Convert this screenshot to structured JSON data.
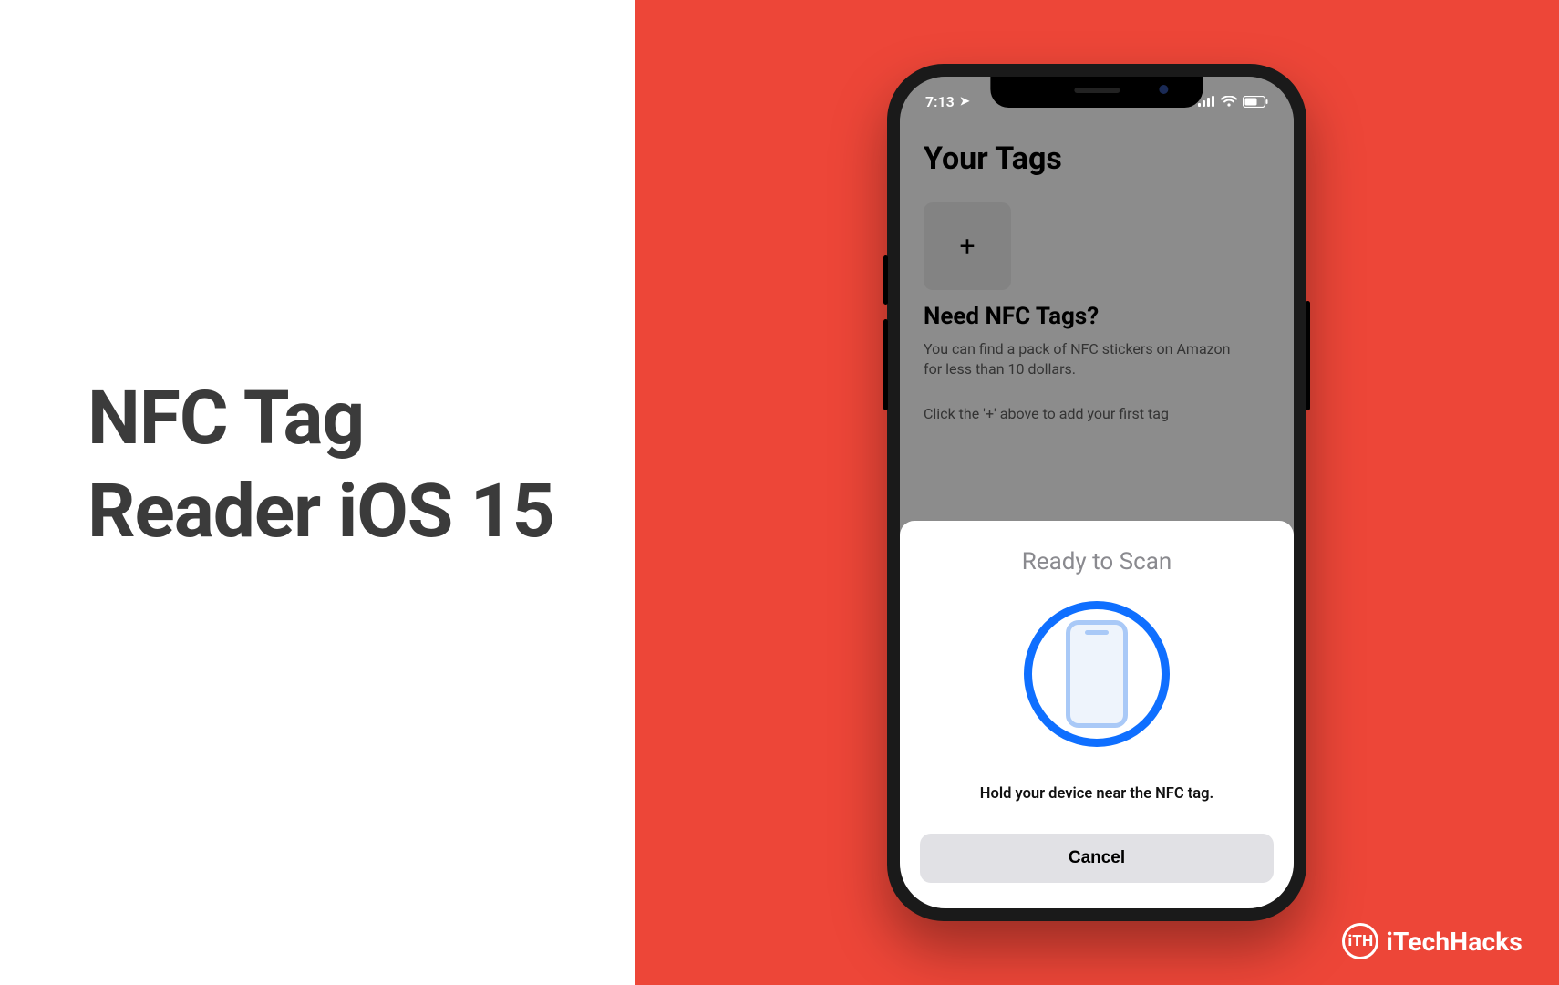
{
  "left": {
    "title_line1": "NFC Tag",
    "title_line2_a": "Reader ",
    "title_line2_b": "iOS 15"
  },
  "phone": {
    "status": {
      "time": "7:13",
      "location_glyph": "➤"
    },
    "app": {
      "title": "Your Tags",
      "add_glyph": "+",
      "need_title": "Need NFC Tags?",
      "need_body": "You can find a pack of NFC stickers on Amazon for less than 10 dollars.",
      "hint": "Click the '+' above to add your first tag"
    },
    "sheet": {
      "title": "Ready to Scan",
      "message": "Hold your device near the NFC tag.",
      "cancel": "Cancel"
    }
  },
  "watermark": {
    "badge": "iTH",
    "text": "iTechHacks"
  },
  "colors": {
    "accent_red": "#ed4638",
    "scan_blue": "#0f6fff"
  }
}
